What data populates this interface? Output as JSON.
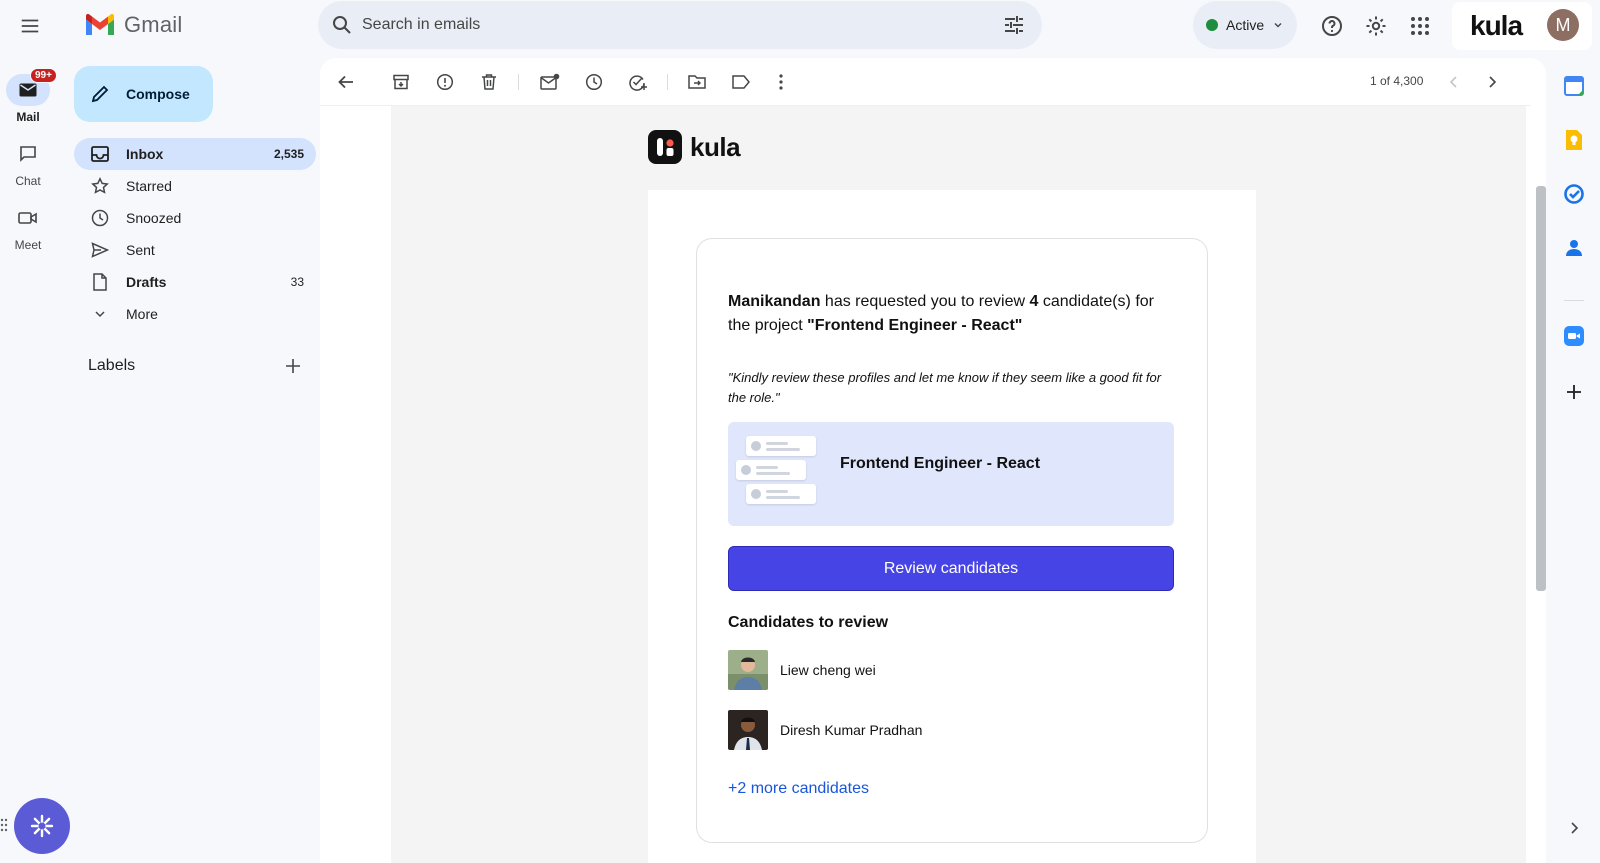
{
  "app": {
    "name": "Gmail",
    "accent": "#0b57d0"
  },
  "search": {
    "placeholder": "Search in emails"
  },
  "status": {
    "label": "Active",
    "color": "#1e8e3e"
  },
  "account": {
    "brand": "kula",
    "avatar_letter": "M"
  },
  "rail": {
    "items": [
      {
        "label": "Mail",
        "badge": "99+",
        "icon": "mail-icon"
      },
      {
        "label": "Chat",
        "icon": "chat-icon"
      },
      {
        "label": "Meet",
        "icon": "video-icon"
      }
    ]
  },
  "sidebar": {
    "compose_label": "Compose",
    "items": [
      {
        "label": "Inbox",
        "count": "2,535",
        "icon": "inbox-icon"
      },
      {
        "label": "Starred",
        "count": "",
        "icon": "star-icon"
      },
      {
        "label": "Snoozed",
        "count": "",
        "icon": "clock-icon"
      },
      {
        "label": "Sent",
        "count": "",
        "icon": "send-icon"
      },
      {
        "label": "Drafts",
        "count": "33",
        "icon": "draft-icon"
      },
      {
        "label": "More",
        "count": "",
        "icon": "chevron-down-icon"
      }
    ],
    "labels_heading": "Labels"
  },
  "toolbar": {
    "pager": "1 of 4,300"
  },
  "email": {
    "brand": "kula",
    "requester": "Manikandan",
    "req_mid": " has requested you to review ",
    "count": "4",
    "req_tail": " candidate(s) for the project ",
    "project_quoted": "\"Frontend Engineer - React\"",
    "quote": "\"Kindly review these profiles and let me know if they seem like a good fit for the role.\"",
    "project_title": "Frontend Engineer - React",
    "button_label": "Review candidates",
    "button_color": "#4744e6",
    "candidates_heading": "Candidates to review",
    "candidates": [
      {
        "name": "Liew cheng wei"
      },
      {
        "name": "Diresh Kumar Pradhan"
      }
    ],
    "more_link": "+2 more candidates"
  }
}
